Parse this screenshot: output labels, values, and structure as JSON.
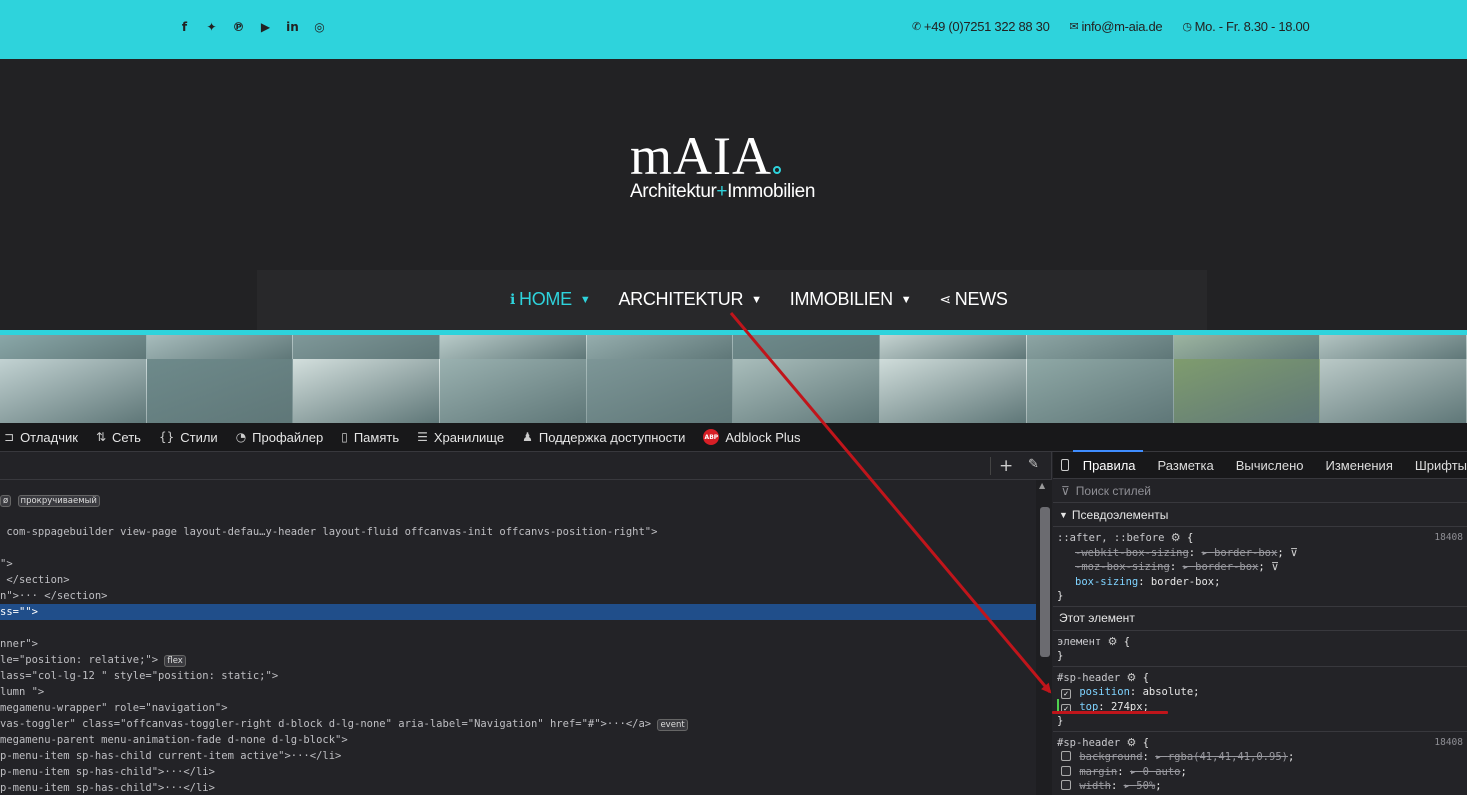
{
  "topbar": {
    "social": [
      {
        "name": "facebook-icon",
        "glyph": "f"
      },
      {
        "name": "twitter-icon",
        "glyph": "✦"
      },
      {
        "name": "pinterest-icon",
        "glyph": "℗"
      },
      {
        "name": "youtube-icon",
        "glyph": "▶"
      },
      {
        "name": "linkedin-icon",
        "glyph": "in"
      },
      {
        "name": "instagram-icon",
        "glyph": "◎"
      }
    ],
    "phone": "+49 (0)7251 322 88 30",
    "email": "info@m-aia.de",
    "hours": "Mo. - Fr. 8.30 - 18.00",
    "phone_icon": "phone-icon",
    "email_icon": "envelope-icon",
    "hours_icon": "clock-icon"
  },
  "logo": {
    "main": "mAIA",
    "sub_left": "Architektur",
    "sub_plus": "+",
    "sub_right": "Immobilien"
  },
  "nav": {
    "items": [
      {
        "label": "HOME",
        "active": true,
        "icon": "ℹ",
        "chevron": true
      },
      {
        "label": "ARCHITEKTUR",
        "active": false,
        "icon": "",
        "chevron": true
      },
      {
        "label": "IMMOBILIEN",
        "active": false,
        "icon": "",
        "chevron": true
      },
      {
        "label": "NEWS",
        "active": false,
        "icon": "⋖",
        "chevron": false
      }
    ]
  },
  "devtools": {
    "tabs": [
      {
        "label": "Отладчик",
        "icon": "⊐"
      },
      {
        "label": "Сеть",
        "icon": "⇅"
      },
      {
        "label": "Стили",
        "icon": "{}"
      },
      {
        "label": "Профайлер",
        "icon": "◔"
      },
      {
        "label": "Память",
        "icon": "▯"
      },
      {
        "label": "Хранилище",
        "icon": "☰"
      },
      {
        "label": "Поддержка доступности",
        "icon": "♟"
      },
      {
        "label": "Adblock Plus",
        "icon": "ABP"
      }
    ],
    "rules_tabs": [
      "Правила",
      "Разметка",
      "Вычислено",
      "Изменения",
      "Шрифты"
    ],
    "filter_placeholder": "Поиск стилей",
    "pseudo_section": "Псевдоэлементы",
    "this_element": "Этот элемент",
    "element_selector": "элемент",
    "pseudo_rule": {
      "selector": "::after, ::before",
      "source": "18408",
      "props": [
        {
          "name": "-webkit-box-sizing",
          "value": "border-box",
          "struck": true
        },
        {
          "name": "-moz-box-sizing",
          "value": "border-box",
          "struck": true
        },
        {
          "name": "box-sizing",
          "value": "border-box",
          "struck": false
        }
      ]
    },
    "sp_header_rule": {
      "selector": "#sp-header",
      "props": [
        {
          "name": "position",
          "value": "absolute"
        },
        {
          "name": "top",
          "value": "274px"
        }
      ]
    },
    "sp_header_rule2": {
      "selector": "#sp-header",
      "source": "18408",
      "props": [
        {
          "name": "background",
          "value": "rgba(41,41,41,0.95)"
        },
        {
          "name": "margin",
          "value": "0 auto"
        },
        {
          "name": "width",
          "value": "50%"
        }
      ]
    },
    "tree": [
      {
        "text": "",
        "badges": [
          "прокручиваемый"
        ],
        "prefix": "ø"
      },
      {
        "text": "blank"
      },
      {
        "text": " com-sppagebuilder view-page layout-defau…y-header layout-fluid offcanvas-init offcanvs-position-right\">"
      },
      {
        "text": "blank"
      },
      {
        "text": "\">"
      },
      {
        "text": " </section>"
      },
      {
        "text": "n\">··· </section>"
      },
      {
        "text": "ss=\"\">",
        "selected": true
      },
      {
        "text": "blank"
      },
      {
        "text": "nner\">"
      },
      {
        "text": "le=\"position: relative;\">",
        "badge": "flex"
      },
      {
        "text": "lass=\"col-lg-12 \" style=\"position: static;\">"
      },
      {
        "text": "lumn \">"
      },
      {
        "text": "megamenu-wrapper\" role=\"navigation\">"
      },
      {
        "text": "vas-toggler\" class=\"offcanvas-toggler-right d-block d-lg-none\" aria-label=\"Navigation\" href=\"#\">···</a>",
        "badge": "event"
      },
      {
        "text": "megamenu-parent menu-animation-fade d-none d-lg-block\">"
      },
      {
        "text": "p-menu-item sp-has-child current-item active\">···</li>"
      },
      {
        "text": "p-menu-item sp-has-child\">···</li>"
      },
      {
        "text": "p-menu-item sp-has-child\">···</li>"
      }
    ]
  }
}
